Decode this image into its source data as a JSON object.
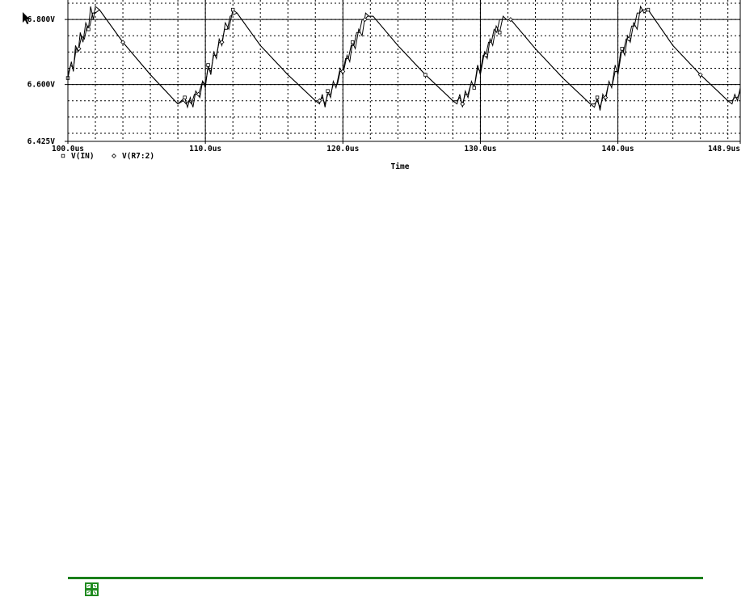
{
  "chart_data": {
    "type": "line",
    "x_unit": "us",
    "xlabel": "Time",
    "xlim": [
      100.0,
      148.9
    ],
    "x_ticks": [
      100.0,
      110.0,
      120.0,
      130.0,
      140.0,
      148.9
    ],
    "x_tick_labels": [
      "100.0us",
      "110.0us",
      "120.0us",
      "130.0us",
      "140.0us",
      "148.9us"
    ],
    "ylim": [
      6.425,
      6.86
    ],
    "y_ticks": [
      6.425,
      6.6,
      6.8
    ],
    "y_tick_labels": [
      "6.425V",
      "6.600V",
      "6.800V"
    ],
    "grid": true,
    "grid_style": "dotted",
    "x_minor_step": 2,
    "y_minor_step": 0.05,
    "legend": [
      {
        "label": "V(IN)",
        "marker": "square"
      },
      {
        "label": "V(R7:2)",
        "marker": "diamond"
      }
    ],
    "series": [
      {
        "name": "V(IN)",
        "marker": "square",
        "x": [
          100.0,
          100.25,
          100.4,
          100.55,
          100.75,
          100.9,
          101.1,
          101.3,
          101.5,
          101.65,
          101.85,
          102.0,
          102.3,
          104.0,
          106.0,
          108.0,
          108.5,
          108.7,
          108.9,
          109.1,
          109.3,
          109.6,
          109.8,
          110.0,
          110.2,
          110.4,
          110.6,
          110.8,
          111.0,
          111.2,
          111.45,
          111.7,
          112.0,
          112.3,
          114.0,
          116.0,
          118.0,
          118.3,
          118.5,
          118.7,
          118.9,
          119.1,
          119.3,
          119.5,
          119.8,
          120.0,
          120.3,
          120.5,
          120.7,
          120.9,
          121.15,
          121.4,
          121.65,
          121.9,
          122.2,
          124.0,
          126.0,
          128.0,
          128.3,
          128.5,
          128.7,
          128.9,
          129.1,
          129.35,
          129.55,
          129.8,
          130.0,
          130.3,
          130.5,
          130.7,
          130.9,
          131.15,
          131.4,
          131.65,
          131.9,
          132.2,
          134.0,
          136.0,
          138.0,
          138.3,
          138.5,
          138.7,
          138.9,
          139.1,
          139.35,
          139.55,
          139.8,
          140.0,
          140.3,
          140.5,
          140.7,
          140.9,
          141.15,
          141.4,
          141.65,
          141.9,
          142.2,
          144.0,
          146.0,
          148.0,
          148.3,
          148.5,
          148.7,
          148.9
        ],
        "y": [
          6.62,
          6.67,
          6.64,
          6.72,
          6.7,
          6.76,
          6.73,
          6.79,
          6.77,
          6.84,
          6.8,
          6.84,
          6.83,
          6.73,
          6.63,
          6.54,
          6.56,
          6.53,
          6.56,
          6.53,
          6.58,
          6.56,
          6.61,
          6.59,
          6.66,
          6.63,
          6.7,
          6.68,
          6.74,
          6.72,
          6.79,
          6.77,
          6.83,
          6.82,
          6.72,
          6.63,
          6.55,
          6.54,
          6.57,
          6.53,
          6.58,
          6.56,
          6.61,
          6.59,
          6.65,
          6.63,
          6.69,
          6.67,
          6.73,
          6.71,
          6.77,
          6.75,
          6.82,
          6.81,
          6.81,
          6.72,
          6.63,
          6.55,
          6.54,
          6.57,
          6.53,
          6.58,
          6.56,
          6.61,
          6.59,
          6.66,
          6.63,
          6.7,
          6.68,
          6.74,
          6.72,
          6.78,
          6.76,
          6.81,
          6.8,
          6.8,
          6.71,
          6.62,
          6.54,
          6.53,
          6.56,
          6.52,
          6.57,
          6.55,
          6.61,
          6.59,
          6.66,
          6.63,
          6.71,
          6.69,
          6.75,
          6.73,
          6.79,
          6.77,
          6.84,
          6.82,
          6.83,
          6.72,
          6.63,
          6.55,
          6.54,
          6.57,
          6.55,
          6.59
        ]
      },
      {
        "name": "V(R7:2)",
        "marker": "diamond",
        "x": [
          100.0,
          100.2,
          100.4,
          100.6,
          100.8,
          101.0,
          101.2,
          101.4,
          101.6,
          101.8,
          102.0,
          102.3,
          104.0,
          106.0,
          108.0,
          108.4,
          108.6,
          108.8,
          109.0,
          109.2,
          109.5,
          109.8,
          110.0,
          110.2,
          110.4,
          110.6,
          110.8,
          111.0,
          111.2,
          111.4,
          111.6,
          111.8,
          112.3,
          114.0,
          116.0,
          118.0,
          118.3,
          118.5,
          118.7,
          118.9,
          119.1,
          119.3,
          119.6,
          119.8,
          120.0,
          120.2,
          120.4,
          120.6,
          120.8,
          121.0,
          121.2,
          121.4,
          121.6,
          121.8,
          122.2,
          124.0,
          126.0,
          128.0,
          128.3,
          128.5,
          128.7,
          128.9,
          129.1,
          129.3,
          129.6,
          129.8,
          130.0,
          130.2,
          130.4,
          130.6,
          130.8,
          131.0,
          131.2,
          131.4,
          131.6,
          131.8,
          132.2,
          134.0,
          136.0,
          138.0,
          138.3,
          138.5,
          138.7,
          138.9,
          139.1,
          139.3,
          139.6,
          139.8,
          140.0,
          140.2,
          140.4,
          140.6,
          140.8,
          141.0,
          141.2,
          141.4,
          141.6,
          141.8,
          142.2,
          144.0,
          146.0,
          148.0,
          148.3,
          148.5,
          148.7,
          148.9
        ],
        "y": [
          6.63,
          6.66,
          6.65,
          6.71,
          6.71,
          6.75,
          6.74,
          6.78,
          6.78,
          6.82,
          6.82,
          6.83,
          6.73,
          6.63,
          6.54,
          6.55,
          6.54,
          6.55,
          6.54,
          6.57,
          6.57,
          6.61,
          6.6,
          6.65,
          6.64,
          6.69,
          6.69,
          6.73,
          6.73,
          6.77,
          6.77,
          6.81,
          6.82,
          6.72,
          6.63,
          6.55,
          6.55,
          6.56,
          6.54,
          6.57,
          6.57,
          6.6,
          6.6,
          6.64,
          6.64,
          6.68,
          6.68,
          6.72,
          6.72,
          6.76,
          6.76,
          6.8,
          6.8,
          6.81,
          6.81,
          6.72,
          6.63,
          6.55,
          6.55,
          6.56,
          6.54,
          6.57,
          6.57,
          6.6,
          6.6,
          6.65,
          6.64,
          6.69,
          6.69,
          6.73,
          6.73,
          6.77,
          6.76,
          6.8,
          6.8,
          6.8,
          6.8,
          6.71,
          6.62,
          6.54,
          6.54,
          6.55,
          6.53,
          6.56,
          6.56,
          6.6,
          6.6,
          6.64,
          6.64,
          6.7,
          6.7,
          6.74,
          6.74,
          6.78,
          6.78,
          6.82,
          6.82,
          6.83,
          6.83,
          6.72,
          6.63,
          6.55,
          6.55,
          6.56,
          6.56,
          6.58
        ]
      }
    ]
  },
  "footer": {
    "rule_color": "#1a7f1a",
    "icon": "ac-adapter-icon",
    "icon_color": "#1f8a1f"
  },
  "cursor": {
    "icon": "arrow-pointer-icon"
  }
}
